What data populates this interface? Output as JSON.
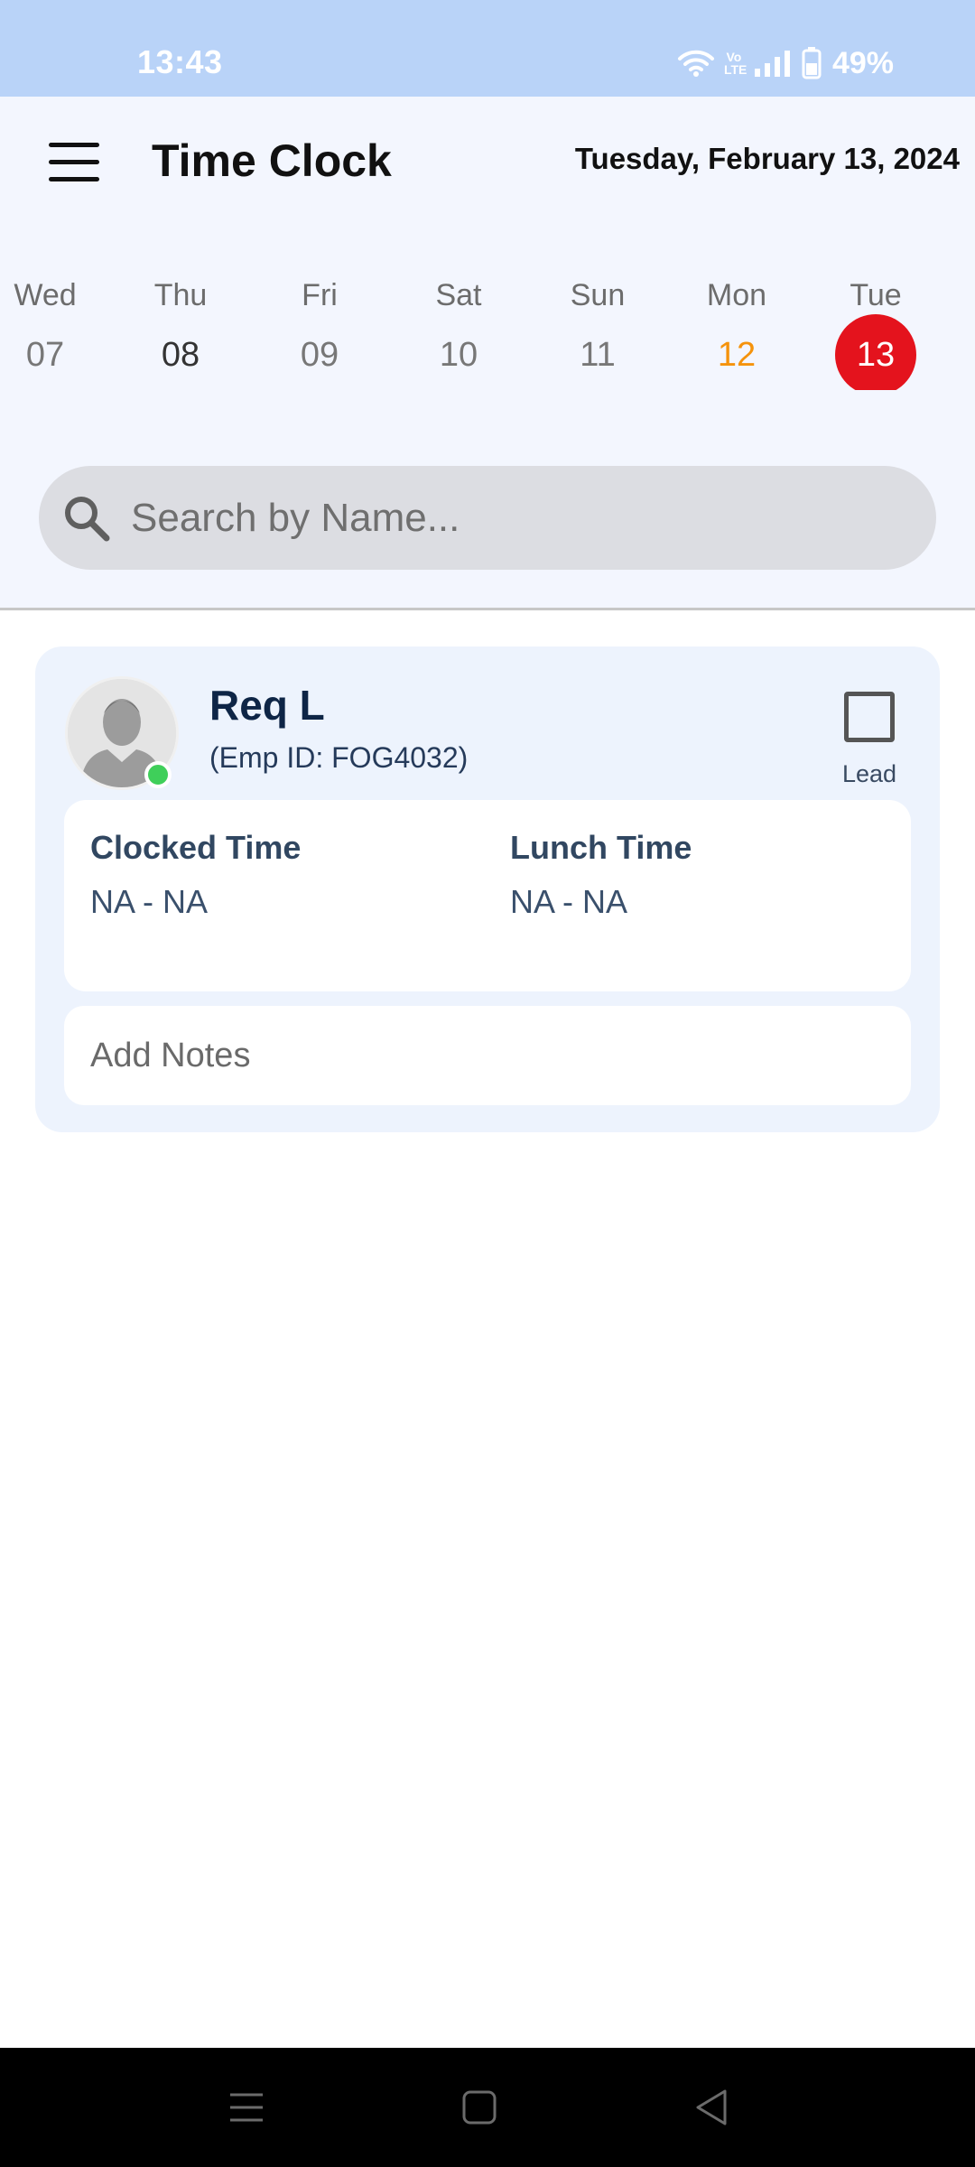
{
  "status_bar": {
    "time": "13:43",
    "volte_text": "Vo LTE",
    "battery": "49%"
  },
  "header": {
    "title": "Time Clock",
    "date": "Tuesday, February 13, 2024"
  },
  "calendar": {
    "days": [
      {
        "dow": "Wed",
        "num": "07",
        "state": "normal"
      },
      {
        "dow": "Thu",
        "num": "08",
        "state": "today"
      },
      {
        "dow": "Fri",
        "num": "09",
        "state": "normal"
      },
      {
        "dow": "Sat",
        "num": "10",
        "state": "normal"
      },
      {
        "dow": "Sun",
        "num": "11",
        "state": "normal"
      },
      {
        "dow": "Mon",
        "num": "12",
        "state": "highlight"
      },
      {
        "dow": "Tue",
        "num": "13",
        "state": "selected"
      }
    ],
    "selected_color": "#e4131d",
    "highlight_color": "#f5930c"
  },
  "search": {
    "placeholder": "Search by Name...",
    "icon": "search-icon"
  },
  "employee": {
    "name": "Req L",
    "emp_id": "(Emp ID: FOG4032)",
    "lead_label": "Lead",
    "lead_checked": false,
    "online": true,
    "clocked_label": "Clocked Time",
    "clocked_value": "NA - NA",
    "lunch_label": "Lunch Time",
    "lunch_value": "NA - NA",
    "notes_placeholder": "Add Notes"
  },
  "nav": {
    "icons": [
      "recent-apps-icon",
      "home-icon",
      "back-icon"
    ]
  }
}
